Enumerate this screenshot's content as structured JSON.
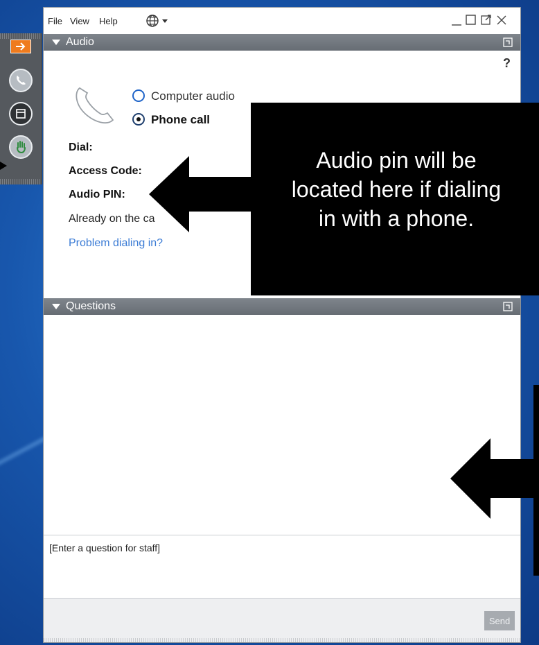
{
  "menu": {
    "file": "File",
    "view": "View",
    "help": "Help"
  },
  "audio_panel": {
    "title": "Audio",
    "help": "?",
    "options": [
      {
        "label": "Computer audio",
        "selected": false
      },
      {
        "label": "Phone call",
        "selected": true
      }
    ],
    "dial_label": "Dial:",
    "access_code_label": "Access Code:",
    "audio_pin_label": "Audio PIN:",
    "already_on_call": "Already on the ca",
    "problem_link": "Problem dialing in?"
  },
  "callout": {
    "text": "Audio pin will be\nlocated here if dialing\nin with a phone."
  },
  "questions_panel": {
    "title": "Questions",
    "input_placeholder": "[Enter a question for staff]",
    "send_label": "Send"
  },
  "colors": {
    "accent_orange": "#ef7b1e",
    "panel_header": "#737980",
    "link": "#3a7bd5",
    "radio": "#1f64c8"
  },
  "icons": [
    "arrow-right-icon",
    "phone-icon",
    "window-icon",
    "raise-hand-icon",
    "globe-icon",
    "minimize-icon",
    "maximize-icon",
    "popout-icon",
    "close-icon"
  ]
}
